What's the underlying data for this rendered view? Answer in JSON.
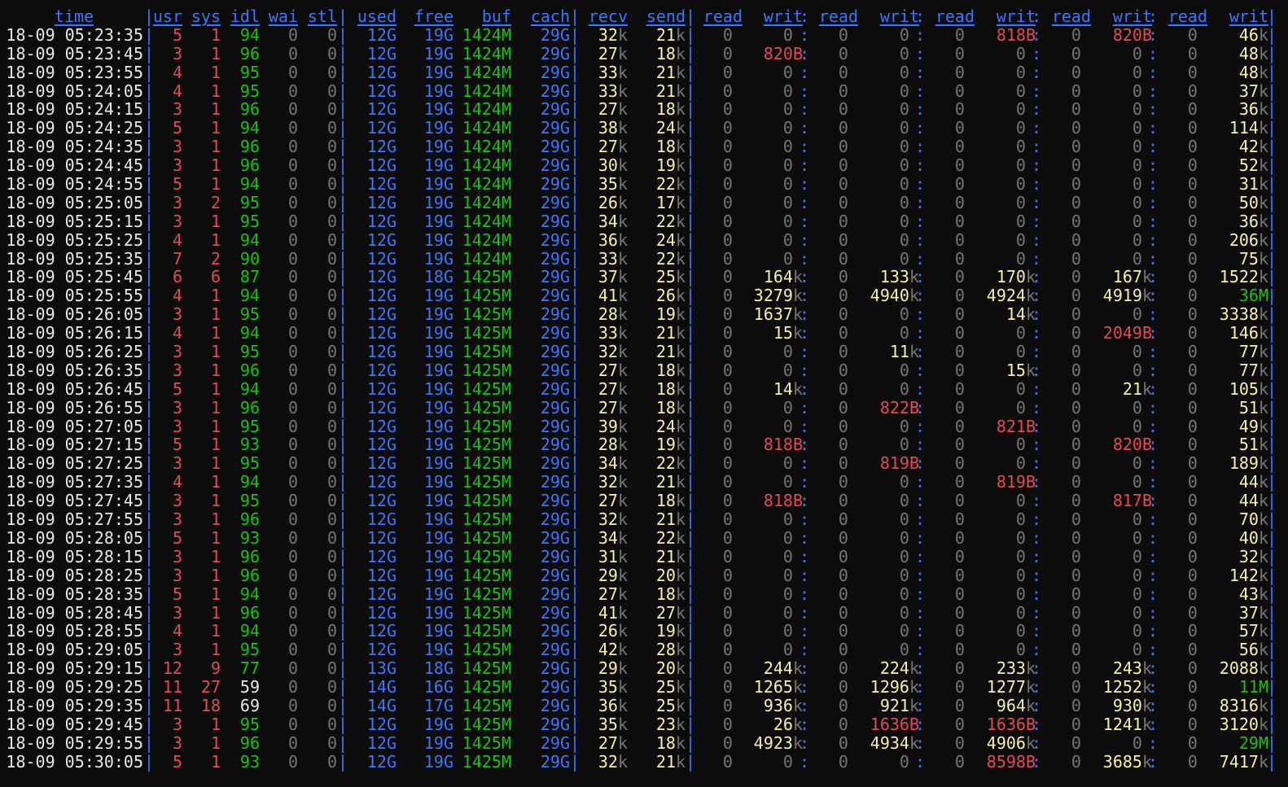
{
  "headers": [
    "time",
    "usr",
    "sys",
    "idl",
    "wai",
    "stl",
    "used",
    "free",
    "buf",
    "cach",
    "recv",
    "send",
    "read",
    "writ",
    "read",
    "writ",
    "read",
    "writ",
    "read",
    "writ",
    "read",
    "writ"
  ],
  "rows": [
    {
      "time": "18-09 05:23:35",
      "usr": "5",
      "sys": "1",
      "idl": "94",
      "wai": "0",
      "stl": "0",
      "used": "12G",
      "free": "19G",
      "buf": "1424M",
      "cach": "29G",
      "recv": "32k",
      "send": "21k",
      "disk": [
        "0",
        "0",
        "0",
        "0",
        "0",
        "818B",
        "0",
        "820B",
        "0",
        "46k"
      ]
    },
    {
      "time": "18-09 05:23:45",
      "usr": "3",
      "sys": "1",
      "idl": "96",
      "wai": "0",
      "stl": "0",
      "used": "12G",
      "free": "19G",
      "buf": "1424M",
      "cach": "29G",
      "recv": "27k",
      "send": "18k",
      "disk": [
        "0",
        "820B",
        "0",
        "0",
        "0",
        "0",
        "0",
        "0",
        "0",
        "48k"
      ]
    },
    {
      "time": "18-09 05:23:55",
      "usr": "4",
      "sys": "1",
      "idl": "95",
      "wai": "0",
      "stl": "0",
      "used": "12G",
      "free": "19G",
      "buf": "1424M",
      "cach": "29G",
      "recv": "33k",
      "send": "21k",
      "disk": [
        "0",
        "0",
        "0",
        "0",
        "0",
        "0",
        "0",
        "0",
        "0",
        "48k"
      ]
    },
    {
      "time": "18-09 05:24:05",
      "usr": "4",
      "sys": "1",
      "idl": "95",
      "wai": "0",
      "stl": "0",
      "used": "12G",
      "free": "19G",
      "buf": "1424M",
      "cach": "29G",
      "recv": "33k",
      "send": "21k",
      "disk": [
        "0",
        "0",
        "0",
        "0",
        "0",
        "0",
        "0",
        "0",
        "0",
        "37k"
      ]
    },
    {
      "time": "18-09 05:24:15",
      "usr": "3",
      "sys": "1",
      "idl": "96",
      "wai": "0",
      "stl": "0",
      "used": "12G",
      "free": "19G",
      "buf": "1424M",
      "cach": "29G",
      "recv": "27k",
      "send": "18k",
      "disk": [
        "0",
        "0",
        "0",
        "0",
        "0",
        "0",
        "0",
        "0",
        "0",
        "36k"
      ]
    },
    {
      "time": "18-09 05:24:25",
      "usr": "5",
      "sys": "1",
      "idl": "94",
      "wai": "0",
      "stl": "0",
      "used": "12G",
      "free": "19G",
      "buf": "1424M",
      "cach": "29G",
      "recv": "38k",
      "send": "24k",
      "disk": [
        "0",
        "0",
        "0",
        "0",
        "0",
        "0",
        "0",
        "0",
        "0",
        "114k"
      ]
    },
    {
      "time": "18-09 05:24:35",
      "usr": "3",
      "sys": "1",
      "idl": "96",
      "wai": "0",
      "stl": "0",
      "used": "12G",
      "free": "19G",
      "buf": "1424M",
      "cach": "29G",
      "recv": "27k",
      "send": "18k",
      "disk": [
        "0",
        "0",
        "0",
        "0",
        "0",
        "0",
        "0",
        "0",
        "0",
        "42k"
      ]
    },
    {
      "time": "18-09 05:24:45",
      "usr": "3",
      "sys": "1",
      "idl": "96",
      "wai": "0",
      "stl": "0",
      "used": "12G",
      "free": "19G",
      "buf": "1424M",
      "cach": "29G",
      "recv": "30k",
      "send": "19k",
      "disk": [
        "0",
        "0",
        "0",
        "0",
        "0",
        "0",
        "0",
        "0",
        "0",
        "52k"
      ]
    },
    {
      "time": "18-09 05:24:55",
      "usr": "5",
      "sys": "1",
      "idl": "94",
      "wai": "0",
      "stl": "0",
      "used": "12G",
      "free": "19G",
      "buf": "1424M",
      "cach": "29G",
      "recv": "35k",
      "send": "22k",
      "disk": [
        "0",
        "0",
        "0",
        "0",
        "0",
        "0",
        "0",
        "0",
        "0",
        "31k"
      ]
    },
    {
      "time": "18-09 05:25:05",
      "usr": "3",
      "sys": "2",
      "idl": "95",
      "wai": "0",
      "stl": "0",
      "used": "12G",
      "free": "19G",
      "buf": "1424M",
      "cach": "29G",
      "recv": "26k",
      "send": "17k",
      "disk": [
        "0",
        "0",
        "0",
        "0",
        "0",
        "0",
        "0",
        "0",
        "0",
        "50k"
      ]
    },
    {
      "time": "18-09 05:25:15",
      "usr": "3",
      "sys": "1",
      "idl": "95",
      "wai": "0",
      "stl": "0",
      "used": "12G",
      "free": "19G",
      "buf": "1424M",
      "cach": "29G",
      "recv": "34k",
      "send": "22k",
      "disk": [
        "0",
        "0",
        "0",
        "0",
        "0",
        "0",
        "0",
        "0",
        "0",
        "36k"
      ]
    },
    {
      "time": "18-09 05:25:25",
      "usr": "4",
      "sys": "1",
      "idl": "94",
      "wai": "0",
      "stl": "0",
      "used": "12G",
      "free": "19G",
      "buf": "1424M",
      "cach": "29G",
      "recv": "36k",
      "send": "24k",
      "disk": [
        "0",
        "0",
        "0",
        "0",
        "0",
        "0",
        "0",
        "0",
        "0",
        "206k"
      ]
    },
    {
      "time": "18-09 05:25:35",
      "usr": "7",
      "sys": "2",
      "idl": "90",
      "wai": "0",
      "stl": "0",
      "used": "12G",
      "free": "19G",
      "buf": "1424M",
      "cach": "29G",
      "recv": "33k",
      "send": "22k",
      "disk": [
        "0",
        "0",
        "0",
        "0",
        "0",
        "0",
        "0",
        "0",
        "0",
        "75k"
      ]
    },
    {
      "time": "18-09 05:25:45",
      "usr": "6",
      "sys": "6",
      "idl": "87",
      "wai": "0",
      "stl": "0",
      "used": "12G",
      "free": "18G",
      "buf": "1425M",
      "cach": "29G",
      "recv": "37k",
      "send": "25k",
      "disk": [
        "0",
        "164k",
        "0",
        "133k",
        "0",
        "170k",
        "0",
        "167k",
        "0",
        "1522k"
      ]
    },
    {
      "time": "18-09 05:25:55",
      "usr": "4",
      "sys": "1",
      "idl": "94",
      "wai": "0",
      "stl": "0",
      "used": "12G",
      "free": "19G",
      "buf": "1425M",
      "cach": "29G",
      "recv": "41k",
      "send": "26k",
      "disk": [
        "0",
        "3279k",
        "0",
        "4940k",
        "0",
        "4924k",
        "0",
        "4919k",
        "0",
        "36M"
      ]
    },
    {
      "time": "18-09 05:26:05",
      "usr": "3",
      "sys": "1",
      "idl": "95",
      "wai": "0",
      "stl": "0",
      "used": "12G",
      "free": "19G",
      "buf": "1425M",
      "cach": "29G",
      "recv": "28k",
      "send": "19k",
      "disk": [
        "0",
        "1637k",
        "0",
        "0",
        "0",
        "14k",
        "0",
        "0",
        "0",
        "3338k"
      ]
    },
    {
      "time": "18-09 05:26:15",
      "usr": "4",
      "sys": "1",
      "idl": "94",
      "wai": "0",
      "stl": "0",
      "used": "12G",
      "free": "19G",
      "buf": "1425M",
      "cach": "29G",
      "recv": "33k",
      "send": "21k",
      "disk": [
        "0",
        "15k",
        "0",
        "0",
        "0",
        "0",
        "0",
        "2049B",
        "0",
        "146k"
      ]
    },
    {
      "time": "18-09 05:26:25",
      "usr": "3",
      "sys": "1",
      "idl": "95",
      "wai": "0",
      "stl": "0",
      "used": "12G",
      "free": "19G",
      "buf": "1425M",
      "cach": "29G",
      "recv": "32k",
      "send": "21k",
      "disk": [
        "0",
        "0",
        "0",
        "11k",
        "0",
        "0",
        "0",
        "0",
        "0",
        "77k"
      ]
    },
    {
      "time": "18-09 05:26:35",
      "usr": "3",
      "sys": "1",
      "idl": "96",
      "wai": "0",
      "stl": "0",
      "used": "12G",
      "free": "19G",
      "buf": "1425M",
      "cach": "29G",
      "recv": "27k",
      "send": "18k",
      "disk": [
        "0",
        "0",
        "0",
        "0",
        "0",
        "15k",
        "0",
        "0",
        "0",
        "77k"
      ]
    },
    {
      "time": "18-09 05:26:45",
      "usr": "5",
      "sys": "1",
      "idl": "94",
      "wai": "0",
      "stl": "0",
      "used": "12G",
      "free": "19G",
      "buf": "1425M",
      "cach": "29G",
      "recv": "27k",
      "send": "18k",
      "disk": [
        "0",
        "14k",
        "0",
        "0",
        "0",
        "0",
        "0",
        "21k",
        "0",
        "105k"
      ]
    },
    {
      "time": "18-09 05:26:55",
      "usr": "3",
      "sys": "1",
      "idl": "96",
      "wai": "0",
      "stl": "0",
      "used": "12G",
      "free": "19G",
      "buf": "1425M",
      "cach": "29G",
      "recv": "27k",
      "send": "18k",
      "disk": [
        "0",
        "0",
        "0",
        "822B",
        "0",
        "0",
        "0",
        "0",
        "0",
        "51k"
      ]
    },
    {
      "time": "18-09 05:27:05",
      "usr": "3",
      "sys": "1",
      "idl": "95",
      "wai": "0",
      "stl": "0",
      "used": "12G",
      "free": "19G",
      "buf": "1425M",
      "cach": "29G",
      "recv": "39k",
      "send": "24k",
      "disk": [
        "0",
        "0",
        "0",
        "0",
        "0",
        "821B",
        "0",
        "0",
        "0",
        "49k"
      ]
    },
    {
      "time": "18-09 05:27:15",
      "usr": "5",
      "sys": "1",
      "idl": "93",
      "wai": "0",
      "stl": "0",
      "used": "12G",
      "free": "19G",
      "buf": "1425M",
      "cach": "29G",
      "recv": "28k",
      "send": "19k",
      "disk": [
        "0",
        "818B",
        "0",
        "0",
        "0",
        "0",
        "0",
        "820B",
        "0",
        "51k"
      ]
    },
    {
      "time": "18-09 05:27:25",
      "usr": "3",
      "sys": "1",
      "idl": "95",
      "wai": "0",
      "stl": "0",
      "used": "12G",
      "free": "19G",
      "buf": "1425M",
      "cach": "29G",
      "recv": "34k",
      "send": "22k",
      "disk": [
        "0",
        "0",
        "0",
        "819B",
        "0",
        "0",
        "0",
        "0",
        "0",
        "189k"
      ]
    },
    {
      "time": "18-09 05:27:35",
      "usr": "4",
      "sys": "1",
      "idl": "94",
      "wai": "0",
      "stl": "0",
      "used": "12G",
      "free": "19G",
      "buf": "1425M",
      "cach": "29G",
      "recv": "32k",
      "send": "21k",
      "disk": [
        "0",
        "0",
        "0",
        "0",
        "0",
        "819B",
        "0",
        "0",
        "0",
        "44k"
      ]
    },
    {
      "time": "18-09 05:27:45",
      "usr": "3",
      "sys": "1",
      "idl": "95",
      "wai": "0",
      "stl": "0",
      "used": "12G",
      "free": "19G",
      "buf": "1425M",
      "cach": "29G",
      "recv": "27k",
      "send": "18k",
      "disk": [
        "0",
        "818B",
        "0",
        "0",
        "0",
        "0",
        "0",
        "817B",
        "0",
        "44k"
      ]
    },
    {
      "time": "18-09 05:27:55",
      "usr": "3",
      "sys": "1",
      "idl": "96",
      "wai": "0",
      "stl": "0",
      "used": "12G",
      "free": "19G",
      "buf": "1425M",
      "cach": "29G",
      "recv": "32k",
      "send": "21k",
      "disk": [
        "0",
        "0",
        "0",
        "0",
        "0",
        "0",
        "0",
        "0",
        "0",
        "70k"
      ]
    },
    {
      "time": "18-09 05:28:05",
      "usr": "5",
      "sys": "1",
      "idl": "93",
      "wai": "0",
      "stl": "0",
      "used": "12G",
      "free": "19G",
      "buf": "1425M",
      "cach": "29G",
      "recv": "34k",
      "send": "22k",
      "disk": [
        "0",
        "0",
        "0",
        "0",
        "0",
        "0",
        "0",
        "0",
        "0",
        "40k"
      ]
    },
    {
      "time": "18-09 05:28:15",
      "usr": "3",
      "sys": "1",
      "idl": "96",
      "wai": "0",
      "stl": "0",
      "used": "12G",
      "free": "19G",
      "buf": "1425M",
      "cach": "29G",
      "recv": "31k",
      "send": "21k",
      "disk": [
        "0",
        "0",
        "0",
        "0",
        "0",
        "0",
        "0",
        "0",
        "0",
        "32k"
      ]
    },
    {
      "time": "18-09 05:28:25",
      "usr": "3",
      "sys": "1",
      "idl": "96",
      "wai": "0",
      "stl": "0",
      "used": "12G",
      "free": "19G",
      "buf": "1425M",
      "cach": "29G",
      "recv": "29k",
      "send": "20k",
      "disk": [
        "0",
        "0",
        "0",
        "0",
        "0",
        "0",
        "0",
        "0",
        "0",
        "142k"
      ]
    },
    {
      "time": "18-09 05:28:35",
      "usr": "5",
      "sys": "1",
      "idl": "94",
      "wai": "0",
      "stl": "0",
      "used": "12G",
      "free": "19G",
      "buf": "1425M",
      "cach": "29G",
      "recv": "27k",
      "send": "18k",
      "disk": [
        "0",
        "0",
        "0",
        "0",
        "0",
        "0",
        "0",
        "0",
        "0",
        "43k"
      ]
    },
    {
      "time": "18-09 05:28:45",
      "usr": "3",
      "sys": "1",
      "idl": "96",
      "wai": "0",
      "stl": "0",
      "used": "12G",
      "free": "19G",
      "buf": "1425M",
      "cach": "29G",
      "recv": "41k",
      "send": "27k",
      "disk": [
        "0",
        "0",
        "0",
        "0",
        "0",
        "0",
        "0",
        "0",
        "0",
        "37k"
      ]
    },
    {
      "time": "18-09 05:28:55",
      "usr": "4",
      "sys": "1",
      "idl": "94",
      "wai": "0",
      "stl": "0",
      "used": "12G",
      "free": "19G",
      "buf": "1425M",
      "cach": "29G",
      "recv": "26k",
      "send": "19k",
      "disk": [
        "0",
        "0",
        "0",
        "0",
        "0",
        "0",
        "0",
        "0",
        "0",
        "57k"
      ]
    },
    {
      "time": "18-09 05:29:05",
      "usr": "3",
      "sys": "1",
      "idl": "95",
      "wai": "0",
      "stl": "0",
      "used": "12G",
      "free": "19G",
      "buf": "1425M",
      "cach": "29G",
      "recv": "42k",
      "send": "28k",
      "disk": [
        "0",
        "0",
        "0",
        "0",
        "0",
        "0",
        "0",
        "0",
        "0",
        "56k"
      ]
    },
    {
      "time": "18-09 05:29:15",
      "usr": "12",
      "sys": "9",
      "idl": "77",
      "wai": "0",
      "stl": "0",
      "used": "13G",
      "free": "18G",
      "buf": "1425M",
      "cach": "29G",
      "recv": "29k",
      "send": "20k",
      "disk": [
        "0",
        "244k",
        "0",
        "224k",
        "0",
        "233k",
        "0",
        "243k",
        "0",
        "2088k"
      ]
    },
    {
      "time": "18-09 05:29:25",
      "usr": "11",
      "sys": "27",
      "idl": "59",
      "wai": "0",
      "stl": "0",
      "used": "14G",
      "free": "16G",
      "buf": "1425M",
      "cach": "29G",
      "recv": "35k",
      "send": "25k",
      "disk": [
        "0",
        "1265k",
        "0",
        "1296k",
        "0",
        "1277k",
        "0",
        "1252k",
        "0",
        "11M"
      ]
    },
    {
      "time": "18-09 05:29:35",
      "usr": "11",
      "sys": "18",
      "idl": "69",
      "wai": "0",
      "stl": "0",
      "used": "14G",
      "free": "17G",
      "buf": "1425M",
      "cach": "29G",
      "recv": "36k",
      "send": "25k",
      "disk": [
        "0",
        "936k",
        "0",
        "921k",
        "0",
        "964k",
        "0",
        "930k",
        "0",
        "8316k"
      ]
    },
    {
      "time": "18-09 05:29:45",
      "usr": "3",
      "sys": "1",
      "idl": "95",
      "wai": "0",
      "stl": "0",
      "used": "12G",
      "free": "19G",
      "buf": "1425M",
      "cach": "29G",
      "recv": "35k",
      "send": "23k",
      "disk": [
        "0",
        "26k",
        "0",
        "1636B",
        "0",
        "1636B",
        "0",
        "1241k",
        "0",
        "3120k"
      ]
    },
    {
      "time": "18-09 05:29:55",
      "usr": "3",
      "sys": "1",
      "idl": "96",
      "wai": "0",
      "stl": "0",
      "used": "12G",
      "free": "19G",
      "buf": "1425M",
      "cach": "29G",
      "recv": "27k",
      "send": "18k",
      "disk": [
        "0",
        "4923k",
        "0",
        "4934k",
        "0",
        "4906k",
        "0",
        "0",
        "0",
        "29M"
      ]
    },
    {
      "time": "18-09 05:30:05",
      "usr": "5",
      "sys": "1",
      "idl": "93",
      "wai": "0",
      "stl": "0",
      "used": "12G",
      "free": "19G",
      "buf": "1425M",
      "cach": "29G",
      "recv": "32k",
      "send": "21k",
      "disk": [
        "0",
        "0",
        "0",
        "0",
        "0",
        "8598B",
        "0",
        "3685k",
        "0",
        "7417k"
      ]
    }
  ],
  "colors": {
    "background": "#0c0c0c",
    "header": "#3b78ff",
    "white": "#e8e8e8",
    "red": "#e74856",
    "green": "#16c60c",
    "blue": "#3b78ff",
    "yellow": "#f9f1a5",
    "dim": "#767676"
  }
}
